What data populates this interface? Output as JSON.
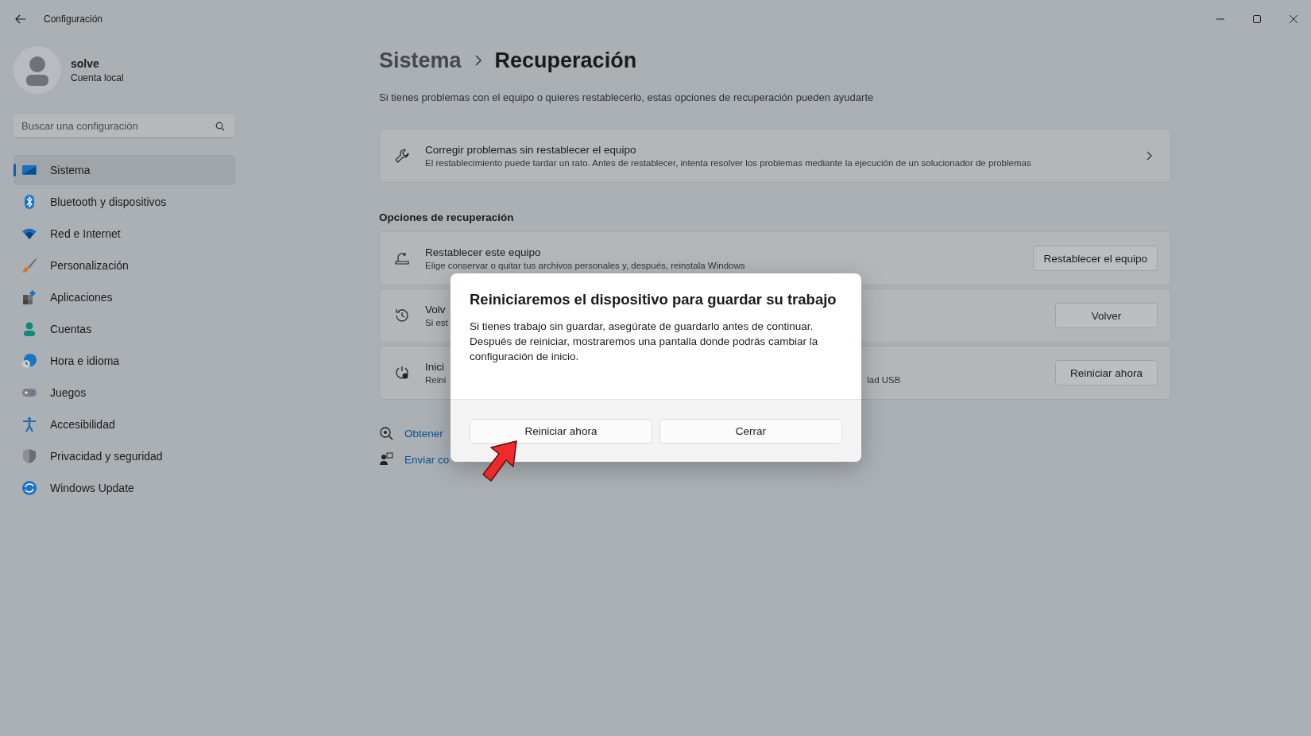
{
  "window": {
    "title": "Configuración"
  },
  "user": {
    "name": "solve",
    "account": "Cuenta local"
  },
  "search": {
    "placeholder": "Buscar una configuración"
  },
  "nav": [
    {
      "label": "Sistema",
      "selected": true
    },
    {
      "label": "Bluetooth y dispositivos",
      "selected": false
    },
    {
      "label": "Red e Internet",
      "selected": false
    },
    {
      "label": "Personalización",
      "selected": false
    },
    {
      "label": "Aplicaciones",
      "selected": false
    },
    {
      "label": "Cuentas",
      "selected": false
    },
    {
      "label": "Hora e idioma",
      "selected": false
    },
    {
      "label": "Juegos",
      "selected": false
    },
    {
      "label": "Accesibilidad",
      "selected": false
    },
    {
      "label": "Privacidad y seguridad",
      "selected": false
    },
    {
      "label": "Windows Update",
      "selected": false
    }
  ],
  "breadcrumb": {
    "parent": "Sistema",
    "current": "Recuperación"
  },
  "subtitle": "Si tienes problemas con el equipo o quieres restablecerlo, estas opciones de recuperación pueden ayudarte",
  "fix_card": {
    "title": "Corregir problemas sin restablecer el equipo",
    "description": "El restablecimiento puede tardar un rato. Antes de restablecer, intenta resolver los problemas mediante la ejecución de un solucionador de problemas"
  },
  "section_title": "Opciones de recuperación",
  "options": [
    {
      "title": "Restablecer este equipo",
      "description": "Elige conservar o quitar tus archivos personales y, después, reinstala Windows",
      "button": "Restablecer el equipo"
    },
    {
      "title": "Volv",
      "description": "Si est",
      "button": "Volver"
    },
    {
      "title": "Inici",
      "description": "Reini",
      "description_tail": "lad USB",
      "button": "Reiniciar ahora"
    }
  ],
  "links": [
    "Obtener",
    "Enviar co"
  ],
  "dialog": {
    "title": "Reiniciaremos el dispositivo para guardar su trabajo",
    "body": "Si tienes trabajo sin guardar, asegúrate de guardarlo antes de continuar. Después de reiniciar, mostraremos una pantalla donde podrás cambiar la configuración de inicio.",
    "buttons": [
      "Reiniciar ahora",
      "Cerrar"
    ]
  }
}
